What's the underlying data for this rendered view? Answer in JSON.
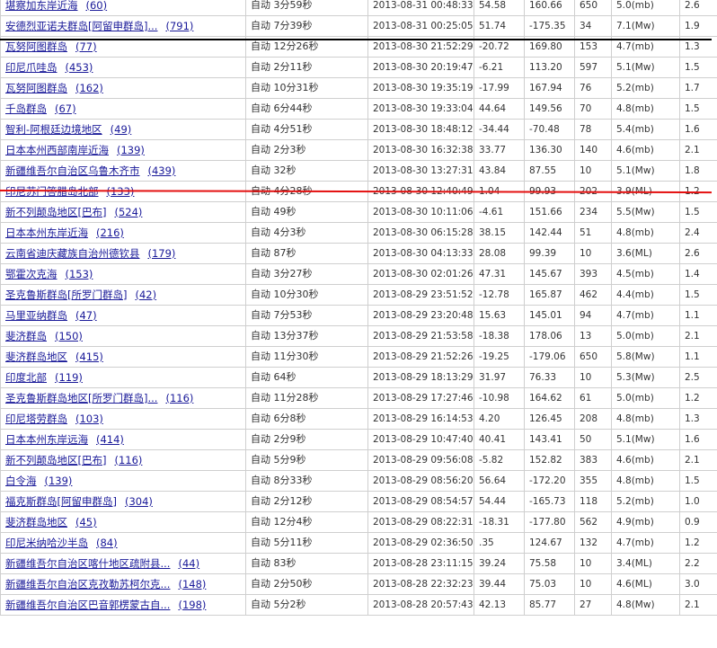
{
  "markers": {
    "black_line_color": "#000000",
    "red_line_color": "#e41010"
  },
  "rows": [
    {
      "region": "堪察加东岸近海",
      "count": "(60)",
      "mode": "自动 3分59秒",
      "time": "2013-08-31 00:48:33.350",
      "lat": "54.58",
      "lon": "160.66",
      "depth": "650",
      "mag": "5.0(mb)",
      "last": "2.6"
    },
    {
      "region": "安德烈亚诺夫群岛[阿留申群岛]...",
      "count": "(791)",
      "mode": "自动 7分39秒",
      "time": "2013-08-31 00:25:05.160",
      "lat": "51.74",
      "lon": "-175.35",
      "depth": "34",
      "mag": "7.1(Mw)",
      "last": "1.9"
    },
    {
      "region": "瓦努阿图群岛",
      "count": "(77)",
      "mode": "自动 12分26秒",
      "time": "2013-08-30 21:52:29.100",
      "lat": "-20.72",
      "lon": "169.80",
      "depth": "153",
      "mag": "4.7(mb)",
      "last": "1.3"
    },
    {
      "region": "印尼爪哇岛",
      "count": "(453)",
      "mode": "自动 2分11秒",
      "time": "2013-08-30 20:19:47.110",
      "lat": "-6.21",
      "lon": "113.20",
      "depth": "597",
      "mag": "5.1(Mw)",
      "last": "1.5"
    },
    {
      "region": "瓦努阿图群岛",
      "count": "(162)",
      "mode": "自动 10分31秒",
      "time": "2013-08-30 19:35:19.830",
      "lat": "-17.99",
      "lon": "167.94",
      "depth": "76",
      "mag": "5.2(mb)",
      "last": "1.7"
    },
    {
      "region": "千岛群岛",
      "count": "(67)",
      "mode": "自动 6分44秒",
      "time": "2013-08-30 19:33:04.220",
      "lat": "44.64",
      "lon": "149.56",
      "depth": "70",
      "mag": "4.8(mb)",
      "last": "1.5"
    },
    {
      "region": "智利-阿根廷边境地区",
      "count": "(49)",
      "mode": "自动 4分51秒",
      "time": "2013-08-30 18:48:12.130",
      "lat": "-34.44",
      "lon": "-70.48",
      "depth": "78",
      "mag": "5.4(mb)",
      "last": "1.6"
    },
    {
      "region": "日本本州西部南岸近海",
      "count": "(139)",
      "mode": "自动 2分3秒",
      "time": "2013-08-30 16:32:38.620",
      "lat": "33.77",
      "lon": "136.30",
      "depth": "140",
      "mag": "4.6(mb)",
      "last": "2.1"
    },
    {
      "region": "新疆维吾尔自治区乌鲁木齐市",
      "count": "(439)",
      "mode": "自动 32秒",
      "time": "2013-08-30 13:27:31.360",
      "lat": "43.84",
      "lon": "87.55",
      "depth": "10",
      "mag": "5.1(Mw)",
      "last": "1.8"
    },
    {
      "region": "印尼苏门答腊岛北部",
      "count": "(133)",
      "mode": "自动 4分28秒",
      "time": "2013-08-30 12:40:49.040",
      "lat": "1.04",
      "lon": "99.93",
      "depth": "202",
      "mag": "3.9(ML)",
      "last": "1.2"
    },
    {
      "region": "新不列颠岛地区[巴布]",
      "count": "(524)",
      "mode": "自动 49秒",
      "time": "2013-08-30 10:11:06.730",
      "lat": "-4.61",
      "lon": "151.66",
      "depth": "234",
      "mag": "5.5(Mw)",
      "last": "1.5"
    },
    {
      "region": "日本本州东岸近海",
      "count": "(216)",
      "mode": "自动 4分3秒",
      "time": "2013-08-30 06:15:28.230",
      "lat": "38.15",
      "lon": "142.44",
      "depth": "51",
      "mag": "4.8(mb)",
      "last": "2.4"
    },
    {
      "region": "云南省迪庆藏族自治州德钦县",
      "count": "(179)",
      "mode": "自动 87秒",
      "time": "2013-08-30 04:13:33.310",
      "lat": "28.08",
      "lon": "99.39",
      "depth": "10",
      "mag": "3.6(ML)",
      "last": "2.6"
    },
    {
      "region": "鄂霍次克海",
      "count": "(153)",
      "mode": "自动 3分27秒",
      "time": "2013-08-30 02:01:26.680",
      "lat": "47.31",
      "lon": "145.67",
      "depth": "393",
      "mag": "4.5(mb)",
      "last": "1.4"
    },
    {
      "region": "圣克鲁斯群岛[所罗门群岛]",
      "count": "(42)",
      "mode": "自动 10分30秒",
      "time": "2013-08-29 23:51:52.000",
      "lat": "-12.78",
      "lon": "165.87",
      "depth": "462",
      "mag": "4.4(mb)",
      "last": "1.5"
    },
    {
      "region": "马里亚纳群岛",
      "count": "(47)",
      "mode": "自动 7分53秒",
      "time": "2013-08-29 23:20:48.430",
      "lat": "15.63",
      "lon": "145.01",
      "depth": "94",
      "mag": "4.7(mb)",
      "last": "1.1"
    },
    {
      "region": "斐济群岛",
      "count": "(150)",
      "mode": "自动 13分37秒",
      "time": "2013-08-29 21:53:58.580",
      "lat": "-18.38",
      "lon": "178.06",
      "depth": "13",
      "mag": "5.0(mb)",
      "last": "2.1"
    },
    {
      "region": "斐济群岛地区",
      "count": "(415)",
      "mode": "自动 11分30秒",
      "time": "2013-08-29 21:52:26.960",
      "lat": "-19.25",
      "lon": "-179.06",
      "depth": "650",
      "mag": "5.8(Mw)",
      "last": "1.1"
    },
    {
      "region": "印度北部",
      "count": "(119)",
      "mode": "自动 64秒",
      "time": "2013-08-29 18:13:29.630",
      "lat": "31.97",
      "lon": "76.33",
      "depth": "10",
      "mag": "5.3(Mw)",
      "last": "2.5"
    },
    {
      "region": "圣克鲁斯群岛地区[所罗门群岛]...",
      "count": "(116)",
      "mode": "自动 11分28秒",
      "time": "2013-08-29 17:27:46.630",
      "lat": "-10.98",
      "lon": "164.62",
      "depth": "61",
      "mag": "5.0(mb)",
      "last": "1.2"
    },
    {
      "region": "印尼塔劳群岛",
      "count": "(103)",
      "mode": "自动 6分8秒",
      "time": "2013-08-29 16:14:53.740",
      "lat": "4.20",
      "lon": "126.45",
      "depth": "208",
      "mag": "4.8(mb)",
      "last": "1.3"
    },
    {
      "region": "日本本州东岸远海",
      "count": "(414)",
      "mode": "自动 2分9秒",
      "time": "2013-08-29 10:47:40.540",
      "lat": "40.41",
      "lon": "143.41",
      "depth": "50",
      "mag": "5.1(Mw)",
      "last": "1.6"
    },
    {
      "region": "新不列颠岛地区[巴布]",
      "count": "(116)",
      "mode": "自动 5分9秒",
      "time": "2013-08-29 09:56:08.580",
      "lat": "-5.82",
      "lon": "152.82",
      "depth": "383",
      "mag": "4.6(mb)",
      "last": "2.1"
    },
    {
      "region": "白令海",
      "count": "(139)",
      "mode": "自动 8分33秒",
      "time": "2013-08-29 08:56:20.200",
      "lat": "56.64",
      "lon": "-172.20",
      "depth": "355",
      "mag": "4.8(mb)",
      "last": "1.5"
    },
    {
      "region": "福克斯群岛[阿留申群岛]",
      "count": "(304)",
      "mode": "自动 2分12秒",
      "time": "2013-08-29 08:54:57.600",
      "lat": "54.44",
      "lon": "-165.73",
      "depth": "118",
      "mag": "5.2(mb)",
      "last": "1.0"
    },
    {
      "region": "斐济群岛地区",
      "count": "(45)",
      "mode": "自动 12分4秒",
      "time": "2013-08-29 08:22:31.640",
      "lat": "-18.31",
      "lon": "-177.80",
      "depth": "562",
      "mag": "4.9(mb)",
      "last": "0.9"
    },
    {
      "region": "印尼米纳哈沙半岛",
      "count": "(84)",
      "mode": "自动 5分11秒",
      "time": "2013-08-29 02:36:50.070",
      "lat": ".35",
      "lon": "124.67",
      "depth": "132",
      "mag": "4.7(mb)",
      "last": "1.2"
    },
    {
      "region": "新疆维吾尔自治区喀什地区疏附县...",
      "count": "(44)",
      "mode": "自动 83秒",
      "time": "2013-08-28 23:11:15.630",
      "lat": "39.24",
      "lon": "75.58",
      "depth": "10",
      "mag": "3.4(ML)",
      "last": "2.2"
    },
    {
      "region": "新疆维吾尔自治区克孜勒苏柯尔克...",
      "count": "(148)",
      "mode": "自动 2分50秒",
      "time": "2013-08-28 22:32:23.290",
      "lat": "39.44",
      "lon": "75.03",
      "depth": "10",
      "mag": "4.6(ML)",
      "last": "3.0"
    },
    {
      "region": "新疆维吾尔自治区巴音郭楞蒙古自...",
      "count": "(198)",
      "mode": "自动 5分2秒",
      "time": "2013-08-28 20:57:43.660",
      "lat": "42.13",
      "lon": "85.77",
      "depth": "27",
      "mag": "4.8(Mw)",
      "last": "2.1"
    }
  ]
}
